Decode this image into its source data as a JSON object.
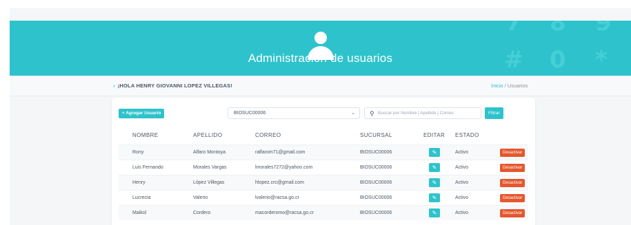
{
  "header": {
    "title": "Administración de usuarios",
    "avatar_icon": "user-icon",
    "decor_glyphs": [
      "7",
      "8",
      "9",
      "#",
      "0",
      "*"
    ]
  },
  "topbar": {
    "greeting": "¡HOLA HENRY GIOVANNI LOPEZ VILLEGAS!",
    "breadcrumb": {
      "home": "Inicio",
      "separator": "/",
      "current": "Usuarios"
    }
  },
  "toolbar": {
    "add_user_label": "+ Agregar Usuario",
    "branch_select_value": "BIOSUC00006",
    "search_placeholder": "Buscar por Nombre | Apellido | Correo",
    "filter_label": "Filtrar"
  },
  "table": {
    "columns": [
      "NOMBRE",
      "APELLIDO",
      "CORREO",
      "SUCURSAL",
      "EDITAR",
      "ESTADO"
    ],
    "rows": [
      {
        "nombre": "Rony",
        "apellido": "Alfaro Montoya",
        "correo": "ralfarom71@gmail.com",
        "sucursal": "BIOSUC00006",
        "estado": "Activo",
        "accion": "Desactivar"
      },
      {
        "nombre": "Luis Fernando",
        "apellido": "Morales Vargas",
        "correo": "lmorales7272@yahoo.com",
        "sucursal": "BIOSUC00006",
        "estado": "Activo",
        "accion": "Desactivar"
      },
      {
        "nombre": "Henry",
        "apellido": "López Villegas",
        "correo": "hlopez.crc@gmail.com",
        "sucursal": "BIOSUC00006",
        "estado": "Activo",
        "accion": "Desactivar"
      },
      {
        "nombre": "Lucrecia",
        "apellido": "Valerio",
        "correo": "lvalerio@racsa.go.cr",
        "sucursal": "BIOSUC00006",
        "estado": "Activo",
        "accion": "Desactivar"
      },
      {
        "nombre": "Maikol",
        "apellido": "Cordero",
        "correo": "macorderomo@racsa.go.cr",
        "sucursal": "BIOSUC00006",
        "estado": "Activo",
        "accion": "Desactivar"
      }
    ]
  },
  "colors": {
    "accent": "#2ec3cc",
    "danger": "#e4572e",
    "text": "#4a5662"
  }
}
